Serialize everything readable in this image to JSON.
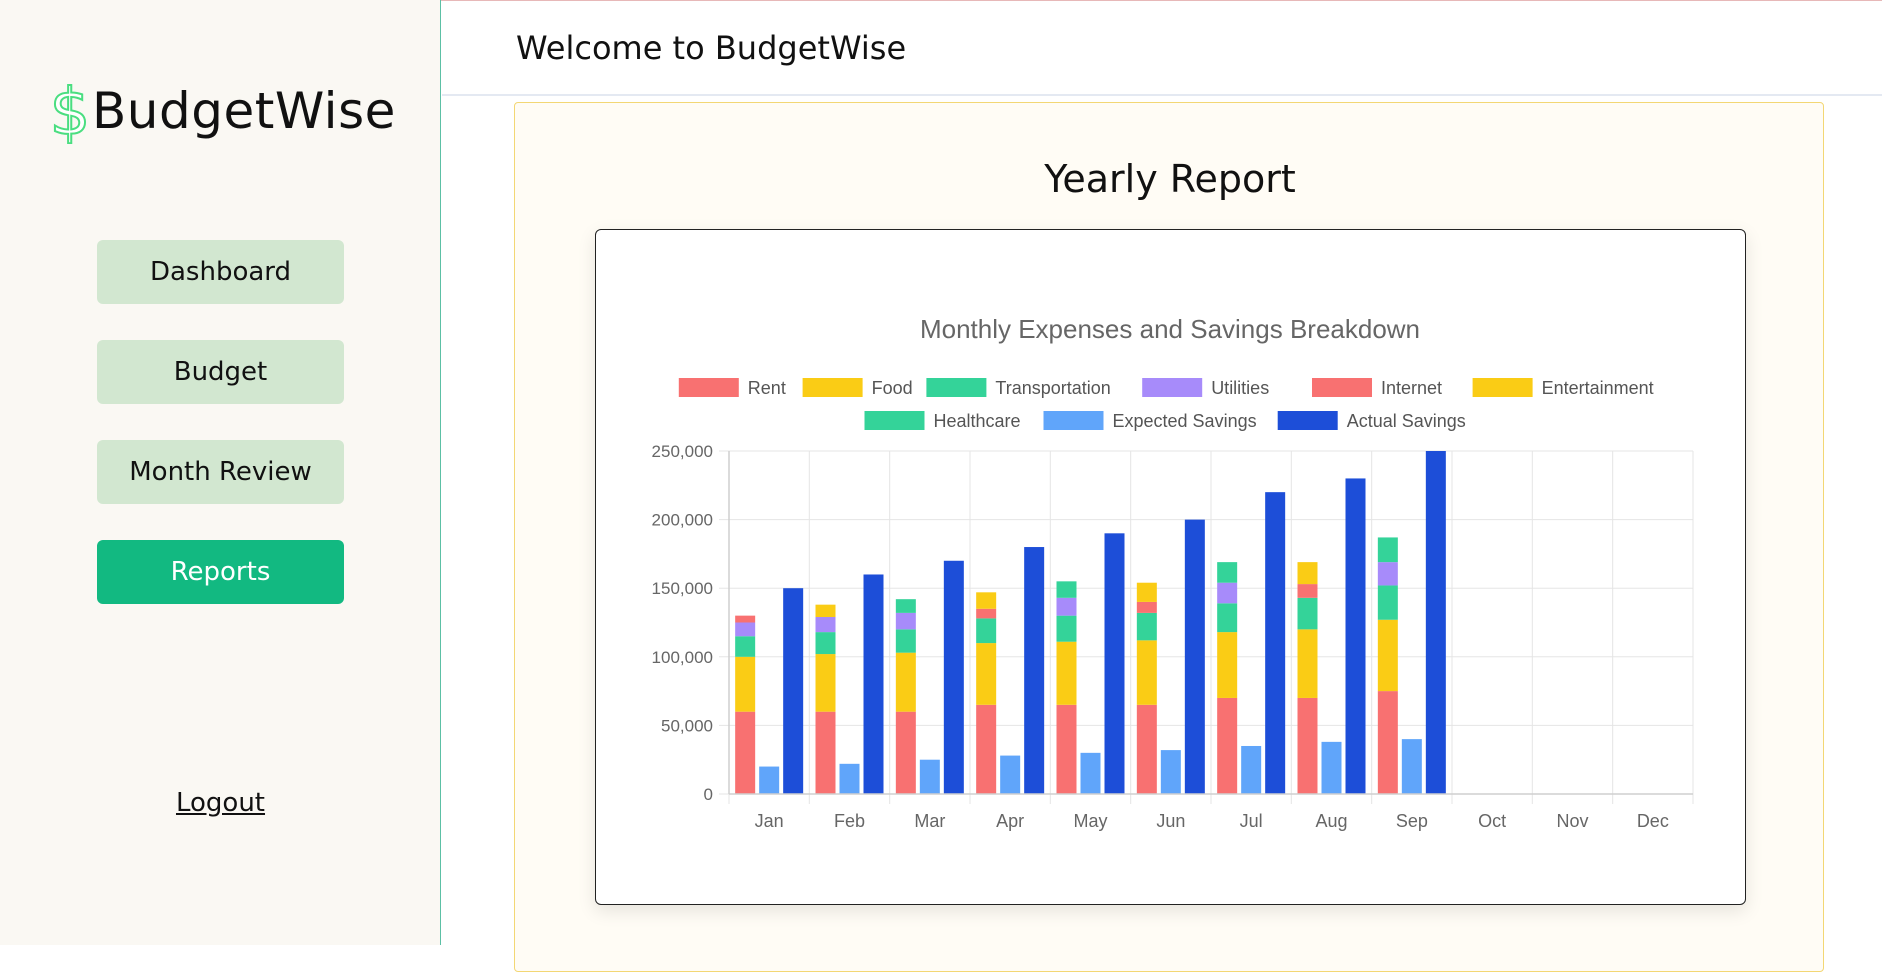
{
  "app": {
    "logo_symbol": "$",
    "logo_text": "BudgetWise",
    "welcome": "Welcome to BudgetWise"
  },
  "sidebar": {
    "items": [
      {
        "label": "Dashboard",
        "active": false
      },
      {
        "label": "Budget",
        "active": false
      },
      {
        "label": "Month Review",
        "active": false
      },
      {
        "label": "Reports",
        "active": true
      }
    ],
    "logout": "Logout"
  },
  "main": {
    "title": "Yearly Report"
  },
  "colors": {
    "accent": "#12b981",
    "nav_bg": "#d2e7d0",
    "logo_icon": "#4ade80"
  },
  "chart_data": {
    "type": "bar",
    "title": "Monthly Expenses and Savings Breakdown",
    "stacked": true,
    "legend_position": "top",
    "grid": true,
    "categories": [
      "Jan",
      "Feb",
      "Mar",
      "Apr",
      "May",
      "Jun",
      "Jul",
      "Aug",
      "Sep",
      "Oct",
      "Nov",
      "Dec"
    ],
    "ylim": [
      0,
      250000
    ],
    "yticks": [
      0,
      50000,
      100000,
      150000,
      200000,
      250000
    ],
    "ytick_labels": [
      "0",
      "50,000",
      "100,000",
      "150,000",
      "200,000",
      "250,000"
    ],
    "series": [
      {
        "name": "Rent",
        "stack": "expenses",
        "color": "#f87171",
        "values": [
          60000,
          60000,
          60000,
          65000,
          65000,
          65000,
          70000,
          70000,
          75000,
          null,
          null,
          null
        ]
      },
      {
        "name": "Food",
        "stack": "expenses",
        "color": "#facc15",
        "values": [
          40000,
          42000,
          43000,
          45000,
          46000,
          47000,
          48000,
          50000,
          52000,
          null,
          null,
          null
        ]
      },
      {
        "name": "Transportation",
        "stack": "expenses",
        "color": "#34d399",
        "values": [
          15000,
          16000,
          17000,
          18000,
          19000,
          20000,
          21000,
          23000,
          25000,
          null,
          null,
          null
        ]
      },
      {
        "name": "Utilities",
        "stack": "expenses",
        "color": "#a78bfa",
        "values": [
          10000,
          11000,
          12000,
          0,
          13000,
          0,
          15000,
          0,
          17000,
          null,
          null,
          null
        ]
      },
      {
        "name": "Internet",
        "stack": "expenses",
        "color": "#f87171",
        "values": [
          5000,
          0,
          0,
          7000,
          0,
          8000,
          0,
          10000,
          0,
          null,
          null,
          null
        ]
      },
      {
        "name": "Entertainment",
        "stack": "expenses",
        "color": "#facc15",
        "values": [
          0,
          9000,
          0,
          12000,
          0,
          14000,
          0,
          16000,
          0,
          null,
          null,
          null
        ]
      },
      {
        "name": "Healthcare",
        "stack": "expenses",
        "color": "#34d399",
        "values": [
          0,
          0,
          10000,
          0,
          12000,
          0,
          15000,
          0,
          18000,
          null,
          null,
          null
        ]
      },
      {
        "name": "Expected Savings",
        "stack": "expected",
        "color": "#60a5fa",
        "values": [
          20000,
          22000,
          25000,
          28000,
          30000,
          32000,
          35000,
          38000,
          40000,
          null,
          null,
          null
        ]
      },
      {
        "name": "Actual Savings",
        "stack": "actual",
        "color": "#1d4ed8",
        "values": [
          150000,
          160000,
          170000,
          180000,
          190000,
          200000,
          220000,
          230000,
          250000,
          null,
          null,
          null
        ]
      }
    ]
  }
}
